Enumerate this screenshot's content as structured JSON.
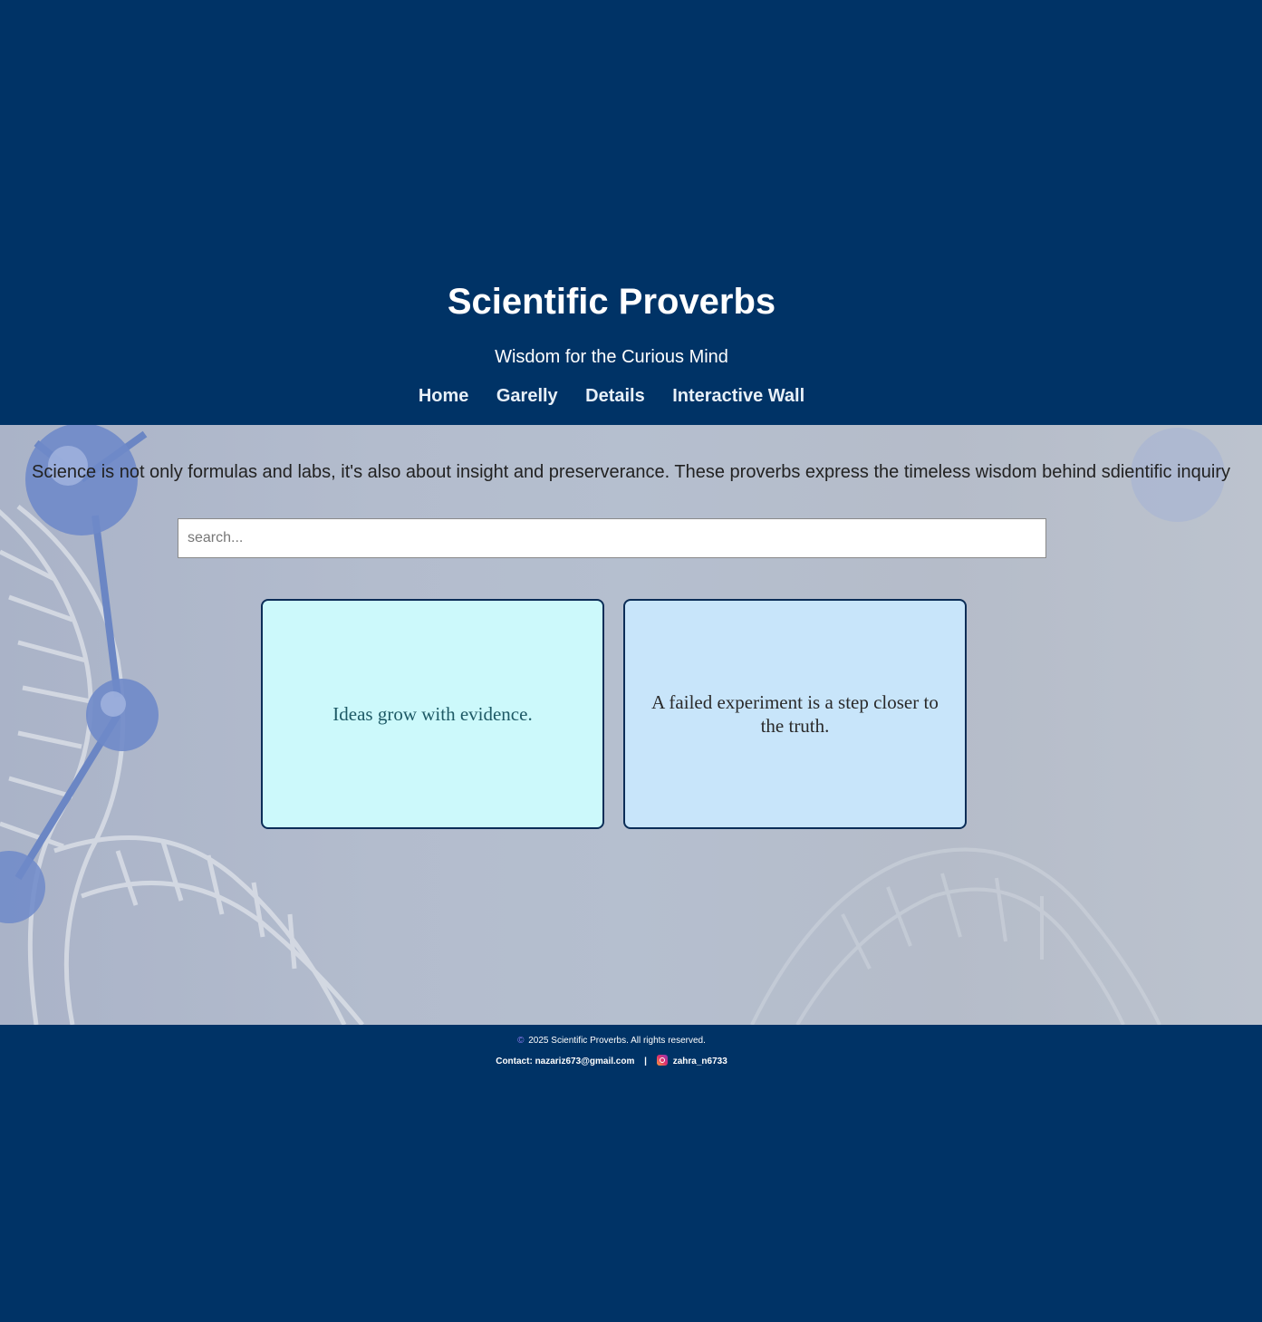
{
  "header": {
    "title": "Scientific Proverbs",
    "tagline": "Wisdom for the Curious Mind",
    "nav": [
      "Home",
      "Garelly",
      "Details",
      "Interactive Wall"
    ]
  },
  "main": {
    "intro": "Science is not only formulas and labs, it's also about insight and preserverance. These proverbs express the timeless wisdom behind sdientific inquiry",
    "search_placeholder": "search...",
    "cards": [
      "Ideas grow with evidence.",
      "A failed experiment is a step closer to the truth."
    ]
  },
  "footer": {
    "copyright_symbol": "©",
    "copyright": "2025 Scientific Proverbs. All rights reserved.",
    "contact_label": "Contact:",
    "email": "nazariz673@gmail.com",
    "separator": "|",
    "instagram_handle": "zahra_n6733"
  },
  "colors": {
    "header_bg": "#003366",
    "card_1_bg": "#ccf9fb",
    "card_2_bg": "#c8e5fa",
    "card_border": "#0b2d57"
  }
}
